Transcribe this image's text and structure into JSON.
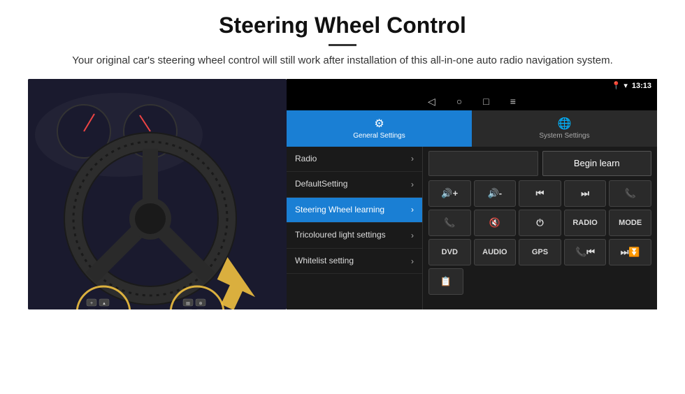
{
  "header": {
    "title": "Steering Wheel Control",
    "divider": true,
    "subtitle": "Your original car's steering wheel control will still work after installation of this all-in-one auto radio navigation system."
  },
  "status_bar": {
    "location_icon": "♥",
    "wifi_icon": "▾",
    "time": "13:13"
  },
  "nav_bar": {
    "back": "◁",
    "home": "○",
    "recent": "□",
    "menu": "≡"
  },
  "tabs": [
    {
      "id": "general",
      "label": "General Settings",
      "icon": "⚙",
      "active": true
    },
    {
      "id": "system",
      "label": "System Settings",
      "icon": "🌐",
      "active": false
    }
  ],
  "menu_items": [
    {
      "label": "Radio",
      "active": false
    },
    {
      "label": "DefaultSetting",
      "active": false
    },
    {
      "label": "Steering Wheel learning",
      "active": true
    },
    {
      "label": "Tricoloured light settings",
      "active": false
    },
    {
      "label": "Whitelist setting",
      "active": false
    }
  ],
  "begin_learn": "Begin learn",
  "controls": {
    "row1": [
      {
        "label": "🔊+",
        "type": "icon"
      },
      {
        "label": "🔊-",
        "type": "icon"
      },
      {
        "label": "⏮",
        "type": "icon"
      },
      {
        "label": "⏭",
        "type": "icon"
      },
      {
        "label": "📞",
        "type": "icon"
      }
    ],
    "row2": [
      {
        "label": "📞",
        "type": "icon"
      },
      {
        "label": "🔇",
        "type": "icon"
      },
      {
        "label": "⏻",
        "type": "icon"
      },
      {
        "label": "RADIO",
        "type": "text"
      },
      {
        "label": "MODE",
        "type": "text"
      }
    ],
    "row3": [
      {
        "label": "DVD",
        "type": "text"
      },
      {
        "label": "AUDIO",
        "type": "text"
      },
      {
        "label": "GPS",
        "type": "text"
      },
      {
        "label": "📞⏮",
        "type": "icon"
      },
      {
        "label": "⏭⏬",
        "type": "icon"
      }
    ],
    "row4": [
      {
        "label": "📋",
        "type": "icon"
      }
    ]
  }
}
